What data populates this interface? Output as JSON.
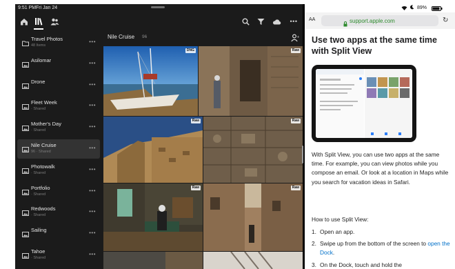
{
  "status": {
    "time": "9:51 PM",
    "date": "Fri Jan 24",
    "battery": "89%"
  },
  "lightroom": {
    "albums": [
      {
        "name": "Travel Photos",
        "sub": "48 Items",
        "type": "folder",
        "selected": false
      },
      {
        "name": "Asilomar",
        "sub": "",
        "type": "album",
        "selected": false
      },
      {
        "name": "Drone",
        "sub": "",
        "type": "album",
        "selected": false
      },
      {
        "name": "Fleet Week",
        "sub": "· Shared",
        "type": "album",
        "selected": false
      },
      {
        "name": "Mother's Day",
        "sub": "· Shared",
        "type": "album",
        "selected": false
      },
      {
        "name": "Nile Cruise",
        "sub": "96 · Shared",
        "type": "album",
        "selected": true
      },
      {
        "name": "Photowalk",
        "sub": "· Shared",
        "type": "album",
        "selected": false
      },
      {
        "name": "Portfolio",
        "sub": "· Shared",
        "type": "album",
        "selected": false
      },
      {
        "name": "Redwoods",
        "sub": "· Shared",
        "type": "album",
        "selected": false
      },
      {
        "name": "Sailing",
        "sub": "",
        "type": "album",
        "selected": false
      },
      {
        "name": "Tahoe",
        "sub": "· Shared",
        "type": "album",
        "selected": false
      }
    ],
    "more_label": "•••",
    "grid_title": "Nile Cruise",
    "grid_count": "96",
    "badges": {
      "dng": "DNG",
      "raw": "Raw"
    }
  },
  "safari": {
    "aa": "AA",
    "url": "support.apple.com",
    "title": "Use two apps at the same time with Split View",
    "para": "With Split View, you can use two apps at the same time. For example, you can view photos while you compose an email. Or look at a location in Maps while you search for vacation ideas in Safari.",
    "how_to": "How to use Split View:",
    "steps": [
      {
        "num": "1.",
        "text": "Open an app.",
        "link": "",
        "after": ""
      },
      {
        "num": "2.",
        "text": "Swipe up from the bottom of the screen to ",
        "link": "open the Dock",
        "after": "."
      },
      {
        "num": "3.",
        "text": "On the Dock, touch and hold the",
        "link": "",
        "after": ""
      }
    ]
  }
}
